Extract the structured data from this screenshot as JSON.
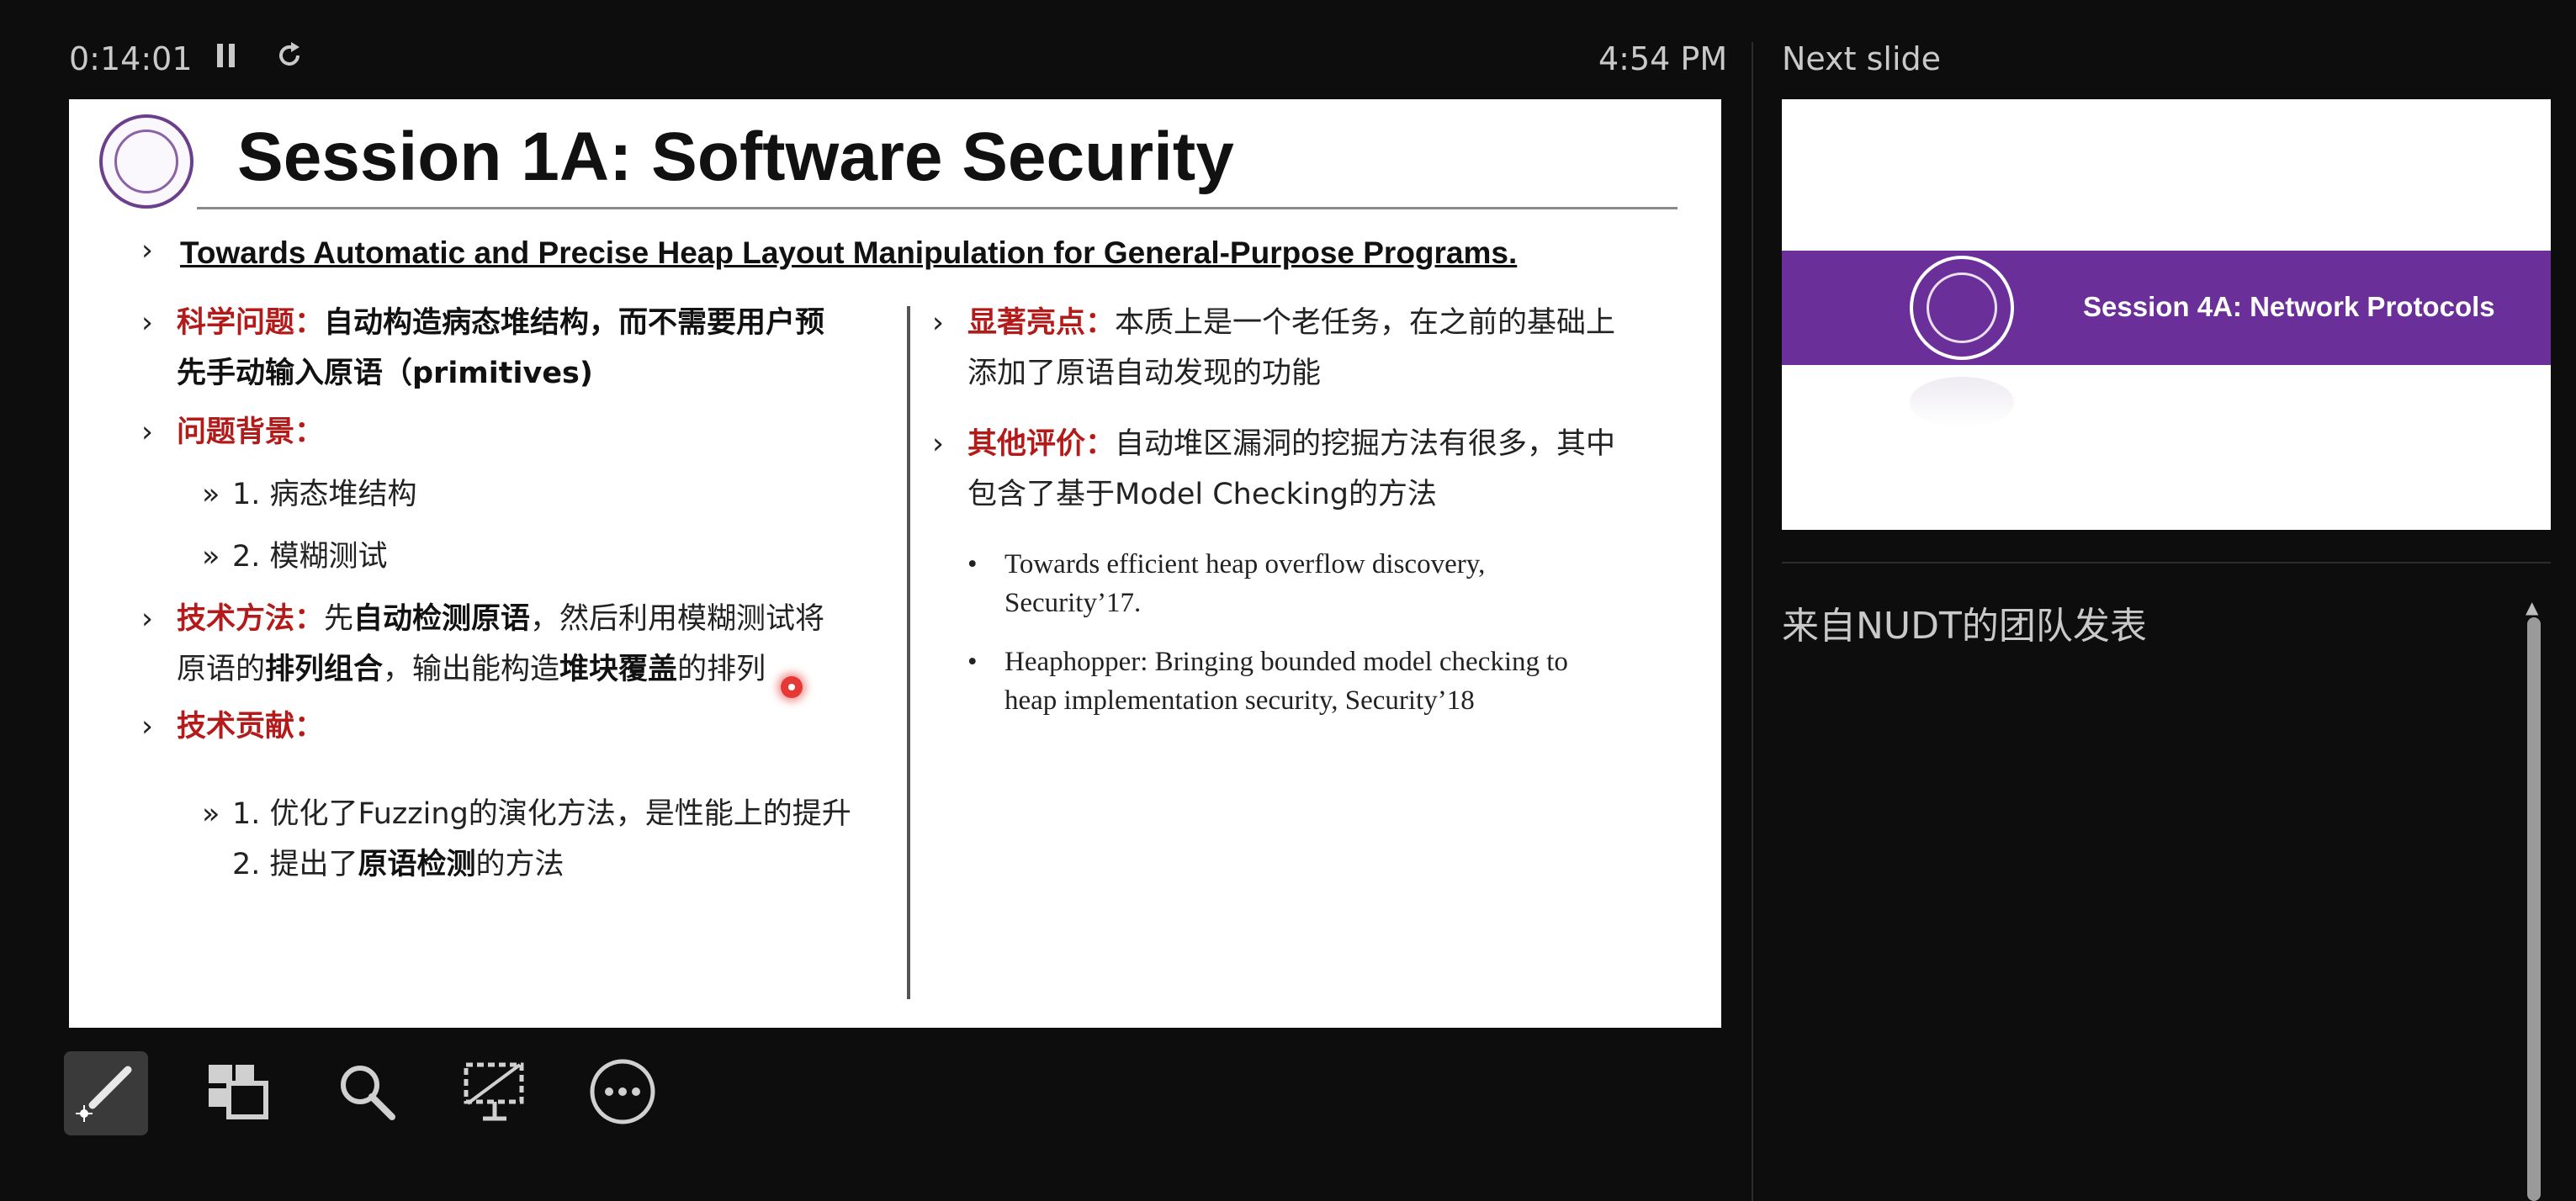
{
  "topbar": {
    "timer": "0:14:01",
    "pause_icon": "pause-icon",
    "restart_icon": "restart-icon",
    "clock": "4:54 PM"
  },
  "slide": {
    "title": "Session 1A: Software Security",
    "paper_title": "Towards Automatic and Precise Heap Layout Manipulation for General-Purpose Programs.",
    "left": {
      "science_label": "科学问题：",
      "science_text_1": "自动构造病态堆结构，而不需要用户预",
      "science_text_2": "先手动输入原语（primitives)",
      "background_label": "问题背景：",
      "bg_item_1": "1. 病态堆结构",
      "bg_item_2": "2. 模糊测试",
      "method_label": "技术方法：",
      "method_1a": "先",
      "method_1b": "自动检测原语",
      "method_1c": "，然后利用模糊测试将",
      "method_2a": "原语的",
      "method_2b": "排列组合",
      "method_2c": "，输出能构造",
      "method_2d": "堆块覆盖",
      "method_2e": "的排列",
      "contrib_label": "技术贡献：",
      "contrib_1": "1.  优化了Fuzzing的演化方法，是性能上的提升",
      "contrib_2a": "2. 提出了",
      "contrib_2b": "原语检测",
      "contrib_2c": "的方法"
    },
    "right": {
      "highlight_label": "显著亮点：",
      "highlight_1": "本质上是一个老任务，在之前的基础上",
      "highlight_2": "添加了原语自动发现的功能",
      "other_label": "其他评价：",
      "other_1": "自动堆区漏洞的挖掘方法有很多，其中",
      "other_2": "包含了基于Model Checking的方法",
      "refs": [
        {
          "line1": "Towards efficient heap overflow discovery,",
          "line2": "Security’17."
        },
        {
          "line1": "Heaphopper: Bringing bounded model checking to",
          "line2": "heap implementation security, Security’18"
        }
      ]
    },
    "bullet_main": "›",
    "bullet_sub": "»"
  },
  "toolbar": {
    "items": [
      "laser-pointer-icon",
      "see-all-slides-icon",
      "zoom-icon",
      "black-screen-icon",
      "more-options-icon"
    ]
  },
  "next": {
    "label": "Next slide",
    "band_text": "Session 4A: Network Protocols"
  },
  "notes": {
    "text": "来自NUDT的团队发表"
  },
  "colors": {
    "accent_purple": "#6a2f98",
    "emphasis_red": "#b31b1b",
    "laser": "#e53935"
  }
}
